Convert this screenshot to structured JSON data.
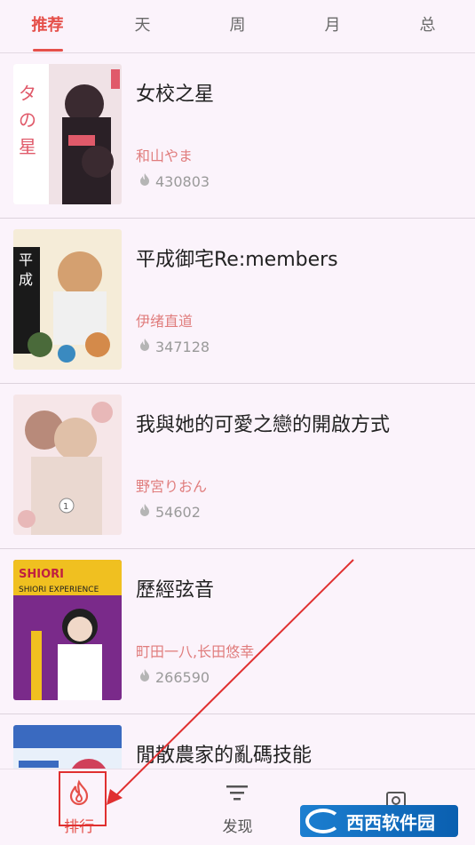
{
  "tabs": [
    {
      "label": "推荐",
      "active": true
    },
    {
      "label": "天",
      "active": false
    },
    {
      "label": "周",
      "active": false
    },
    {
      "label": "月",
      "active": false
    },
    {
      "label": "总",
      "active": false
    }
  ],
  "items": [
    {
      "title": "女校之星",
      "author": "和山やま",
      "hot": "430803",
      "cover_colors": [
        "#f0e2e6",
        "#3a2a30",
        "#e05a6a"
      ]
    },
    {
      "title": "平成御宅Re:members",
      "author": "伊绪直道",
      "hot": "347128",
      "cover_colors": [
        "#f5ecd8",
        "#4a6a3a",
        "#d48a4a"
      ]
    },
    {
      "title": "我與她的可愛之戀的開啟方式",
      "author": "野宮りおん",
      "hot": "54602",
      "cover_colors": [
        "#f6e6e8",
        "#b88a7a",
        "#e8b8b8"
      ]
    },
    {
      "title": "歷經弦音",
      "author": "町田一八,长田悠幸",
      "hot": "266590",
      "cover_colors": [
        "#7a2a8a",
        "#f0c020",
        "#202020"
      ]
    },
    {
      "title": "閒散農家的亂碼技能",
      "author": "",
      "hot": "",
      "cover_colors": [
        "#e8f0fa",
        "#3a6ac0",
        "#d0405a"
      ]
    }
  ],
  "bottom_nav": [
    {
      "label": "排行",
      "icon": "flame-icon",
      "active": true
    },
    {
      "label": "发现",
      "icon": "filter-icon",
      "active": false
    },
    {
      "label": "",
      "icon": "profile-icon",
      "active": false
    }
  ],
  "watermark": {
    "text": "西西软件园"
  },
  "colors": {
    "accent": "#e5504a",
    "author": "#e07d7d",
    "background": "#fbf3fb"
  }
}
